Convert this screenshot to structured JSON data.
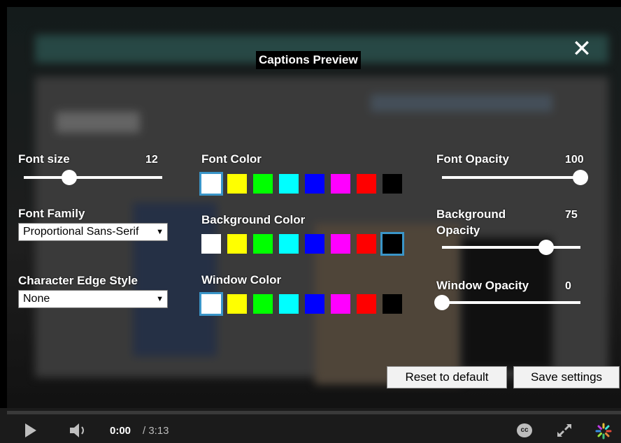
{
  "preview_title": "Captions Preview",
  "close": {
    "icon": "close-icon"
  },
  "font_size": {
    "label": "Font size",
    "value": "12",
    "level_percent": 33
  },
  "font_family": {
    "label": "Font Family",
    "selected": "Proportional Sans-Serif"
  },
  "edge_style": {
    "label": "Character Edge Style",
    "selected": "None"
  },
  "font_color": {
    "label": "Font Color",
    "selected": "white"
  },
  "background_color": {
    "label": "Background Color",
    "selected": "black"
  },
  "window_color": {
    "label": "Window Color",
    "selected": "white"
  },
  "swatches": [
    {
      "name": "white",
      "hex": "#ffffff"
    },
    {
      "name": "yellow",
      "hex": "#ffff00"
    },
    {
      "name": "green",
      "hex": "#00ff00"
    },
    {
      "name": "cyan",
      "hex": "#00ffff"
    },
    {
      "name": "blue",
      "hex": "#0000ff"
    },
    {
      "name": "magenta",
      "hex": "#ff00ff"
    },
    {
      "name": "red",
      "hex": "#ff0000"
    },
    {
      "name": "black",
      "hex": "#000000"
    }
  ],
  "font_opacity": {
    "label": "Font Opacity",
    "value": "100",
    "level_percent": 100
  },
  "background_opacity": {
    "label_line1": "Background",
    "label_line2": "Opacity",
    "value": "75",
    "level_percent": 75
  },
  "window_opacity": {
    "label": "Window Opacity",
    "value": "0",
    "level_percent": 0
  },
  "buttons": {
    "reset": "Reset to default",
    "save": "Save settings"
  },
  "player": {
    "current_time": "0:00",
    "duration": "/ 3:13",
    "icons": [
      "play-icon",
      "volume-icon",
      "cc-icon",
      "fullscreen-icon",
      "loading-icon"
    ],
    "cc_label": "cc"
  },
  "colors": {
    "selection": "#3a95c8",
    "bar": "#1b1b1b"
  }
}
